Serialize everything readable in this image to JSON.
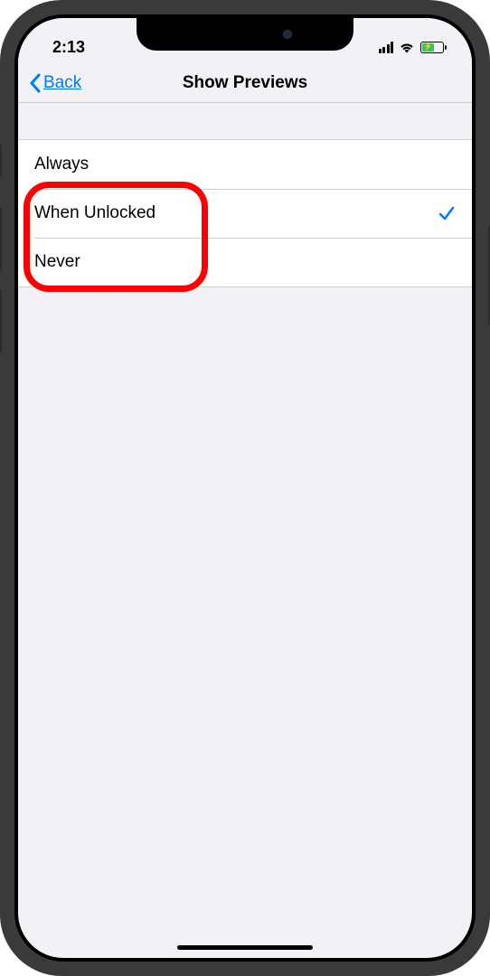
{
  "status": {
    "time": "2:13"
  },
  "nav": {
    "back_label": "Back",
    "title": "Show Previews"
  },
  "options": [
    {
      "label": "Always",
      "selected": false
    },
    {
      "label": "When Unlocked",
      "selected": true
    },
    {
      "label": "Never",
      "selected": false
    }
  ],
  "colors": {
    "accent": "#007aff",
    "annotation": "#ff0000"
  }
}
